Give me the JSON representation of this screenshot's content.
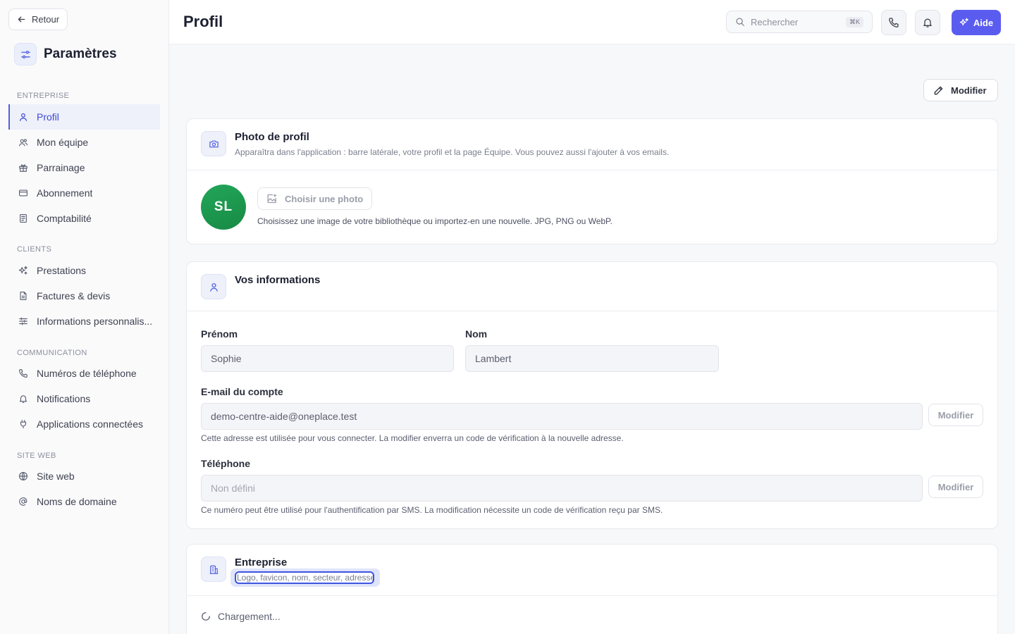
{
  "sidebar": {
    "back_label": "Retour",
    "title": "Paramètres",
    "sections": [
      {
        "heading": "ENTREPRISE",
        "items": [
          {
            "label": "Profil",
            "icon": "user-icon"
          },
          {
            "label": "Mon équipe",
            "icon": "team-icon"
          },
          {
            "label": "Parrainage",
            "icon": "gift-icon"
          },
          {
            "label": "Abonnement",
            "icon": "credit-card-icon"
          },
          {
            "label": "Comptabilité",
            "icon": "ledger-icon"
          }
        ]
      },
      {
        "heading": "CLIENTS",
        "items": [
          {
            "label": "Prestations",
            "icon": "sparkles-icon"
          },
          {
            "label": "Factures & devis",
            "icon": "invoice-icon"
          },
          {
            "label": "Informations personnalis...",
            "icon": "sliders-icon"
          }
        ]
      },
      {
        "heading": "COMMUNICATION",
        "items": [
          {
            "label": "Numéros de téléphone",
            "icon": "phone-icon"
          },
          {
            "label": "Notifications",
            "icon": "bell-icon"
          },
          {
            "label": "Applications connectées",
            "icon": "plug-icon"
          }
        ]
      },
      {
        "heading": "SITE WEB",
        "items": [
          {
            "label": "Site web",
            "icon": "globe-icon"
          },
          {
            "label": "Noms de domaine",
            "icon": "at-sign-icon"
          }
        ]
      }
    ]
  },
  "header": {
    "title": "Profil",
    "search_placeholder": "Rechercher",
    "search_shortcut": "⌘K",
    "help_label": "Aide"
  },
  "main": {
    "edit_label": "Modifier",
    "photo_card": {
      "title": "Photo de profil",
      "subtitle": "Apparaîtra dans l'application : barre latérale, votre profil et la page Équipe. Vous pouvez aussi l'ajouter à vos emails.",
      "avatar_initials": "SL",
      "choose_label": "Choisir une photo",
      "hint": "Choisissez une image de votre bibliothèque ou importez-en une nouvelle. JPG, PNG ou WebP."
    },
    "info_card": {
      "title": "Vos informations",
      "first_name_label": "Prénom",
      "first_name_value": "Sophie",
      "last_name_label": "Nom",
      "last_name_value": "Lambert",
      "email_label": "E-mail du compte",
      "email_value": "demo-centre-aide@oneplace.test",
      "email_modify": "Modifier",
      "email_help": "Cette adresse est utilisée pour vous connecter. La modifier enverra un code de vérification à la nouvelle adresse.",
      "phone_label": "Téléphone",
      "phone_placeholder": "Non défini",
      "phone_modify": "Modifier",
      "phone_help": "Ce numéro peut être utilisé pour l'authentification par SMS. La modification nécessite un code de vérification reçu par SMS."
    },
    "company_card": {
      "title": "Entreprise",
      "subtitle": "Logo, favicon, nom, secteur, adresse",
      "loading": "Chargement..."
    }
  },
  "colors": {
    "accent": "#5a5cf0",
    "active_nav": "#3b4bd6",
    "avatar": "#1f9d55"
  }
}
